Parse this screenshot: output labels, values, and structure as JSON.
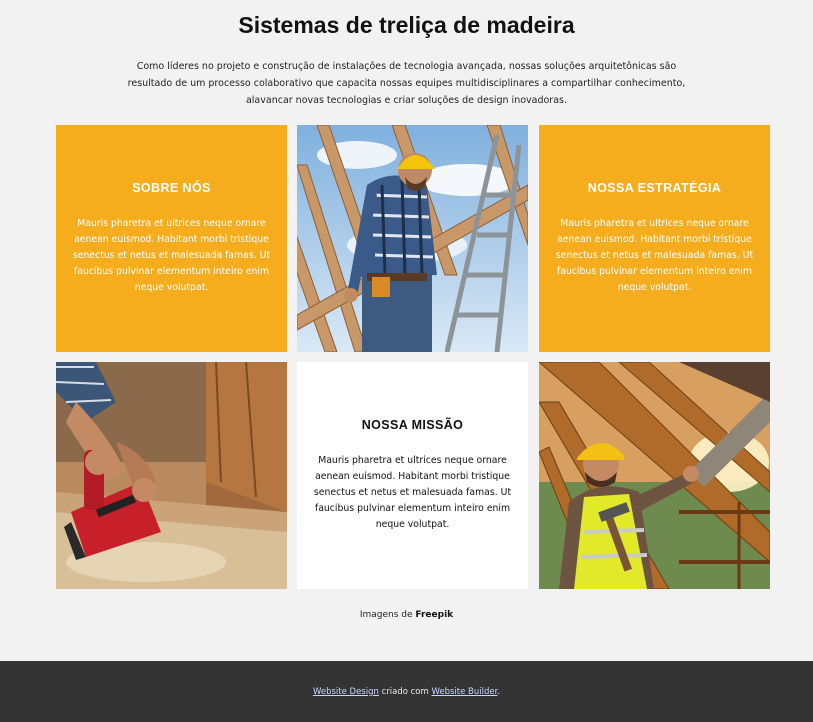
{
  "header": {
    "title": "Sistemas de treliça de madeira",
    "intro": "Como líderes no projeto e construção de instalações de tecnologia avançada, nossas soluções arquitetônicas são resultado de um processo colaborativo que capacita nossas equipes multidisciplinares a compartilhar conhecimento, alavancar novas tecnologias e criar soluções de design inovadoras."
  },
  "cards": {
    "about": {
      "title": "SOBRE NÓS",
      "text": "Mauris pharetra et ultrices neque ornare aenean euismod. Habitant morbi tristique senectus et netus et malesuada famas. Ut faucibus pulvinar elementum inteiro enim neque volutpat."
    },
    "strategy": {
      "title": "NOSSA ESTRATÉGIA",
      "text": "Mauris pharetra et ultrices neque ornare aenean euismod. Habitant morbi tristique senectus et netus et malesuada famas. Ut faucibus pulvinar elementum inteiro enim neque volutpat."
    },
    "mission": {
      "title": "NOSSA MISSÃO",
      "text": "Mauris pharetra et ultrices neque ornare aenean euismod. Habitant morbi tristique senectus et netus et malesuada famas. Ut faucibus pulvinar elementum inteiro enim neque volutpat."
    }
  },
  "credit": {
    "prefix": "Imagens de ",
    "source": "Freepik"
  },
  "footer": {
    "link1": "Website Design",
    "middle": " criado com ",
    "link2": "Website Builder",
    "suffix": "."
  },
  "colors": {
    "accent": "#f5ad1e",
    "background": "#f2f2f2",
    "footer": "#343434"
  }
}
